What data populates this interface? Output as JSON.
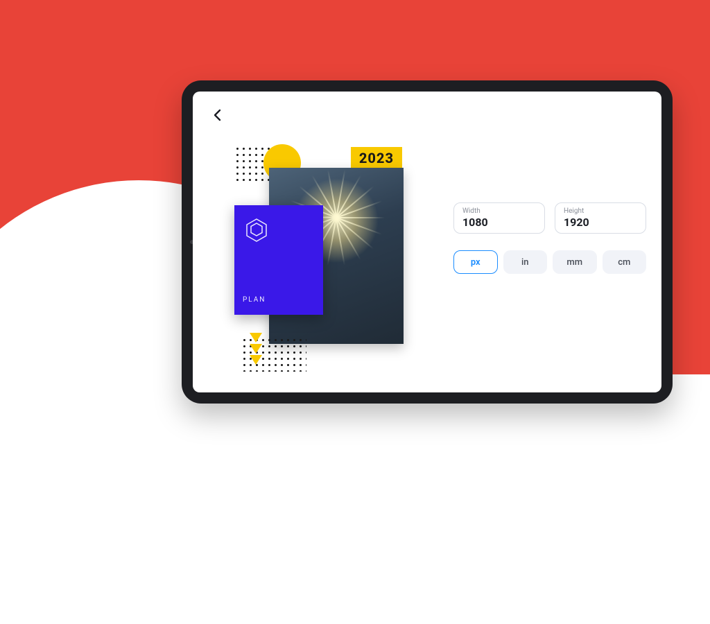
{
  "preview": {
    "year_badge": "2023",
    "blue_card_label": "PLAN"
  },
  "dimensions": {
    "width_label": "Width",
    "width_value": "1080",
    "height_label": "Height",
    "height_value": "1920"
  },
  "units": [
    {
      "label": "px",
      "selected": true
    },
    {
      "label": "in",
      "selected": false
    },
    {
      "label": "mm",
      "selected": false
    },
    {
      "label": "cm",
      "selected": false
    }
  ]
}
